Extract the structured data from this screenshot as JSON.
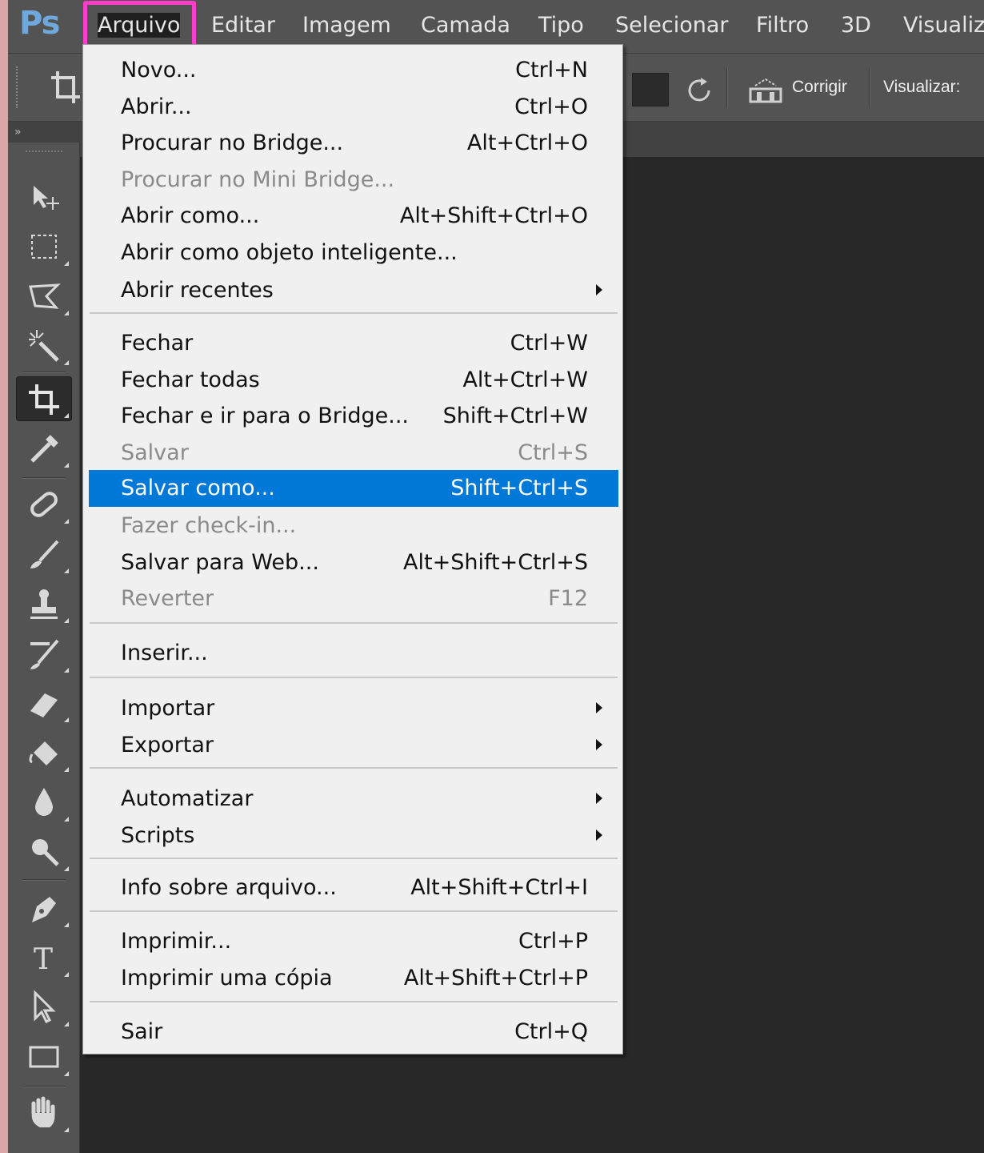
{
  "app": {
    "logo": "Ps"
  },
  "menubar": {
    "items": [
      "Arquivo",
      "Editar",
      "Imagem",
      "Camada",
      "Tipo",
      "Selecionar",
      "Filtro",
      "3D",
      "Visualiza"
    ],
    "active": "Arquivo",
    "highlight_color": "#ff3fc8"
  },
  "options_bar": {
    "straighten_label": "Corrigir",
    "view_label": "Visualizar:"
  },
  "toolbar": {
    "collapse_glyph": "»",
    "tools": [
      "move-tool",
      "marquee-tool",
      "lasso-tool",
      "magic-wand-tool",
      "crop-tool",
      "eyedropper-tool",
      "healing-brush-tool",
      "brush-tool",
      "clone-stamp-tool",
      "history-brush-tool",
      "eraser-tool",
      "paint-bucket-tool",
      "blur-tool",
      "dodge-tool",
      "pen-tool",
      "type-tool",
      "path-selection-tool",
      "rectangle-tool",
      "hand-tool"
    ],
    "selected": "crop-tool",
    "type_glyph": "T"
  },
  "file_menu": {
    "highlight_color": "#0078d7",
    "items": [
      {
        "label": "Novo...",
        "shortcut": "Ctrl+N"
      },
      {
        "label": "Abrir...",
        "shortcut": "Ctrl+O"
      },
      {
        "label": "Procurar no Bridge...",
        "shortcut": "Alt+Ctrl+O"
      },
      {
        "label": "Procurar no Mini Bridge...",
        "shortcut": "",
        "disabled": true
      },
      {
        "label": "Abrir como...",
        "shortcut": "Alt+Shift+Ctrl+O"
      },
      {
        "label": "Abrir como objeto inteligente...",
        "shortcut": ""
      },
      {
        "label": "Abrir recentes",
        "shortcut": "",
        "submenu": true
      },
      {
        "label": "Fechar",
        "shortcut": "Ctrl+W"
      },
      {
        "label": "Fechar todas",
        "shortcut": "Alt+Ctrl+W"
      },
      {
        "label": "Fechar e ir para o Bridge...",
        "shortcut": "Shift+Ctrl+W"
      },
      {
        "label": "Salvar",
        "shortcut": "Ctrl+S",
        "disabled": true
      },
      {
        "label": "Salvar como...",
        "shortcut": "Shift+Ctrl+S",
        "highlighted": true
      },
      {
        "label": "Fazer check-in...",
        "shortcut": "",
        "disabled": true
      },
      {
        "label": "Salvar para Web...",
        "shortcut": "Alt+Shift+Ctrl+S"
      },
      {
        "label": "Reverter",
        "shortcut": "F12",
        "disabled": true
      },
      {
        "label": "Inserir...",
        "shortcut": ""
      },
      {
        "label": "Importar",
        "shortcut": "",
        "submenu": true
      },
      {
        "label": "Exportar",
        "shortcut": "",
        "submenu": true
      },
      {
        "label": "Automatizar",
        "shortcut": "",
        "submenu": true
      },
      {
        "label": "Scripts",
        "shortcut": "",
        "submenu": true
      },
      {
        "label": "Info sobre arquivo...",
        "shortcut": "Alt+Shift+Ctrl+I"
      },
      {
        "label": "Imprimir...",
        "shortcut": "Ctrl+P"
      },
      {
        "label": "Imprimir uma cópia",
        "shortcut": "Alt+Shift+Ctrl+P"
      },
      {
        "label": "Sair",
        "shortcut": "Ctrl+Q"
      }
    ]
  }
}
